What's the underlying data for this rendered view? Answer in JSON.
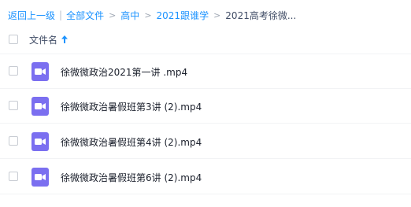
{
  "breadcrumb": {
    "back": "返回上一级",
    "items": [
      "全部文件",
      "高中",
      "2021跟谁学"
    ],
    "current": "2021高考徐微..."
  },
  "header": {
    "column_name": "文件名"
  },
  "files": [
    {
      "name": "徐微微政治2021第一讲 .mp4",
      "icon": "video-file-icon"
    },
    {
      "name": "徐微微政治暑假班第3讲 (2).mp4",
      "icon": "video-file-icon"
    },
    {
      "name": "徐微微政治暑假班第4讲 (2).mp4",
      "icon": "video-file-icon"
    },
    {
      "name": "徐微微政治暑假班第6讲 (2).mp4",
      "icon": "video-file-icon"
    }
  ],
  "colors": {
    "link": "#1c93ff",
    "video_icon": "#7b6ff0"
  }
}
